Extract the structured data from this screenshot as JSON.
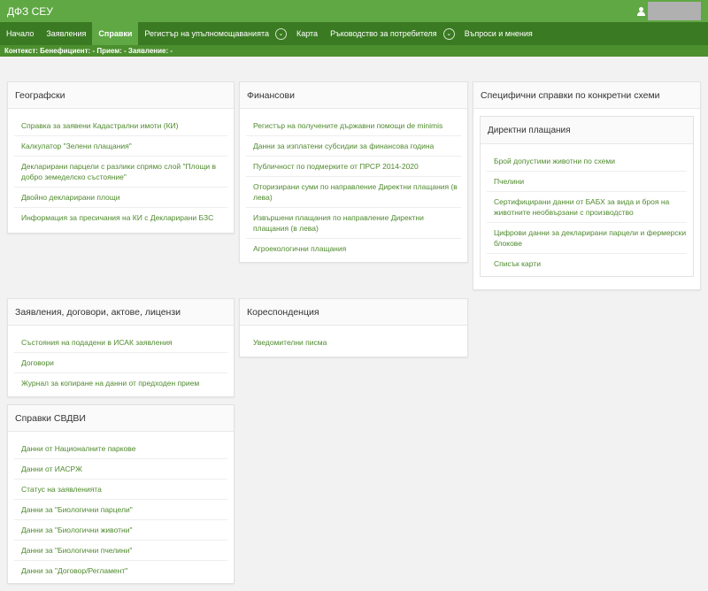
{
  "header": {
    "brand": "ДФЗ СЕУ"
  },
  "nav": {
    "items": [
      {
        "label": "Начало",
        "active": false
      },
      {
        "label": "Заявления",
        "active": false
      },
      {
        "label": "Справки",
        "active": true
      },
      {
        "label": "Регистър на упълномощаванията",
        "active": false,
        "dropdown": true
      },
      {
        "label": "Карта",
        "active": false
      },
      {
        "label": "Ръководство за потребителя",
        "active": false,
        "dropdown": true
      },
      {
        "label": "Въпроси и мнения",
        "active": false
      }
    ]
  },
  "context": {
    "text": "Контекст: Бенефициент: - Прием: - Заявление: -"
  },
  "panels": {
    "geo": {
      "title": "Географски",
      "links": [
        "Справка за заявени Кадастрални имоти (КИ)",
        "Калкулатор \"Зелени плащания\"",
        "Декларирани парцели с разлики спрямо слой \"Площи в добро земеделско състояние\"",
        "Двойно декларирани площи",
        "Информация за пресичания на КИ с Декларирани БЗС"
      ]
    },
    "fin": {
      "title": "Финансови",
      "links": [
        "Регистър на получените държавни помощи de minimis",
        "Данни за изплатени субсидии за финансова година",
        "Публичност по подмерките от ПРСР 2014-2020",
        "Оторизирани суми по направление Директни плащания (в лева)",
        "Извършени плащания по направление Директни плащания (в лева)",
        "Агроекологични плащания"
      ]
    },
    "spec": {
      "title": "Специфични справки по конкретни схеми",
      "sub": {
        "title": "Директни плащания",
        "links": [
          "Брой допустими животни по схеми",
          "Пчелини",
          "Сертифицирани данни от БАБХ за вида и броя на животните необвързани с производство",
          "Цифрови данни за декларирани парцели и фермерски блокове",
          "Списък карти"
        ]
      }
    },
    "apps": {
      "title": "Заявления, договори, актове, лицензи",
      "links": [
        "Състояния на подадени в ИСАК заявления",
        "Договори",
        "Журнал за копиране на данни от предходен прием"
      ]
    },
    "corr": {
      "title": "Кореспонденция",
      "links": [
        "Уведомителни писма"
      ]
    },
    "svdvi": {
      "title": "Справки СВДВИ",
      "links": [
        "Данни от Националните паркове",
        "Данни от ИАСРЖ",
        "Статус на заявленията",
        "Данни за \"Биологични парцели\"",
        "Данни за \"Биологични животни\"",
        "Данни за \"Биологични пчелини\"",
        "Данни за \"Договор/Регламент\""
      ]
    }
  }
}
